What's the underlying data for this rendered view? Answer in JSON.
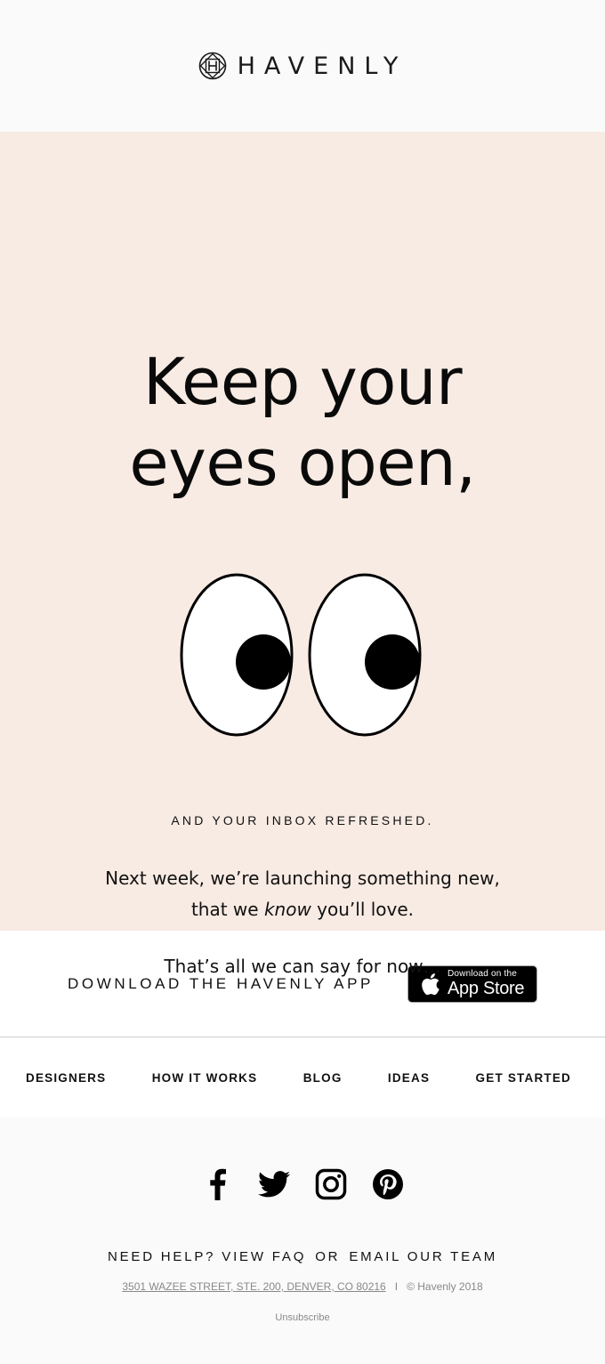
{
  "header": {
    "brand": "HAVENLY",
    "logo_icon": "havenly-emblem-icon"
  },
  "hero": {
    "headline_line1": "Keep your",
    "headline_line2": "eyes open,",
    "illustration": "googly-eyes-icon",
    "subhead": "AND YOUR INBOX REFRESHED.",
    "body_line1": "Next week, we’re launching something new,",
    "body_line2_pre": "that we ",
    "body_line2_em": "know",
    "body_line2_post": " you’ll love.",
    "teaser": "That’s all we can say for now…",
    "background_color": "#f8ebe3"
  },
  "app": {
    "label": "DOWNLOAD THE HAVENLY APP",
    "badge_small": "Download on the",
    "badge_big": "App Store",
    "badge_icon": "apple-icon"
  },
  "nav": {
    "items": [
      {
        "label": "DESIGNERS"
      },
      {
        "label": "HOW IT WORKS"
      },
      {
        "label": "BLOG"
      },
      {
        "label": "IDEAS"
      },
      {
        "label": "GET STARTED"
      }
    ]
  },
  "footer": {
    "social": [
      {
        "name": "facebook-icon"
      },
      {
        "name": "twitter-icon"
      },
      {
        "name": "instagram-icon"
      },
      {
        "name": "pinterest-icon"
      }
    ],
    "help_prefix": "NEED HELP? VIEW FAQ",
    "help_or": "OR",
    "help_email": "EMAIL OUR TEAM",
    "address": "3501 WAZEE STREET, STE. 200, DENVER, CO 80216",
    "separator": "I",
    "copyright": "© Havenly 2018",
    "unsubscribe": "Unsubscribe"
  }
}
